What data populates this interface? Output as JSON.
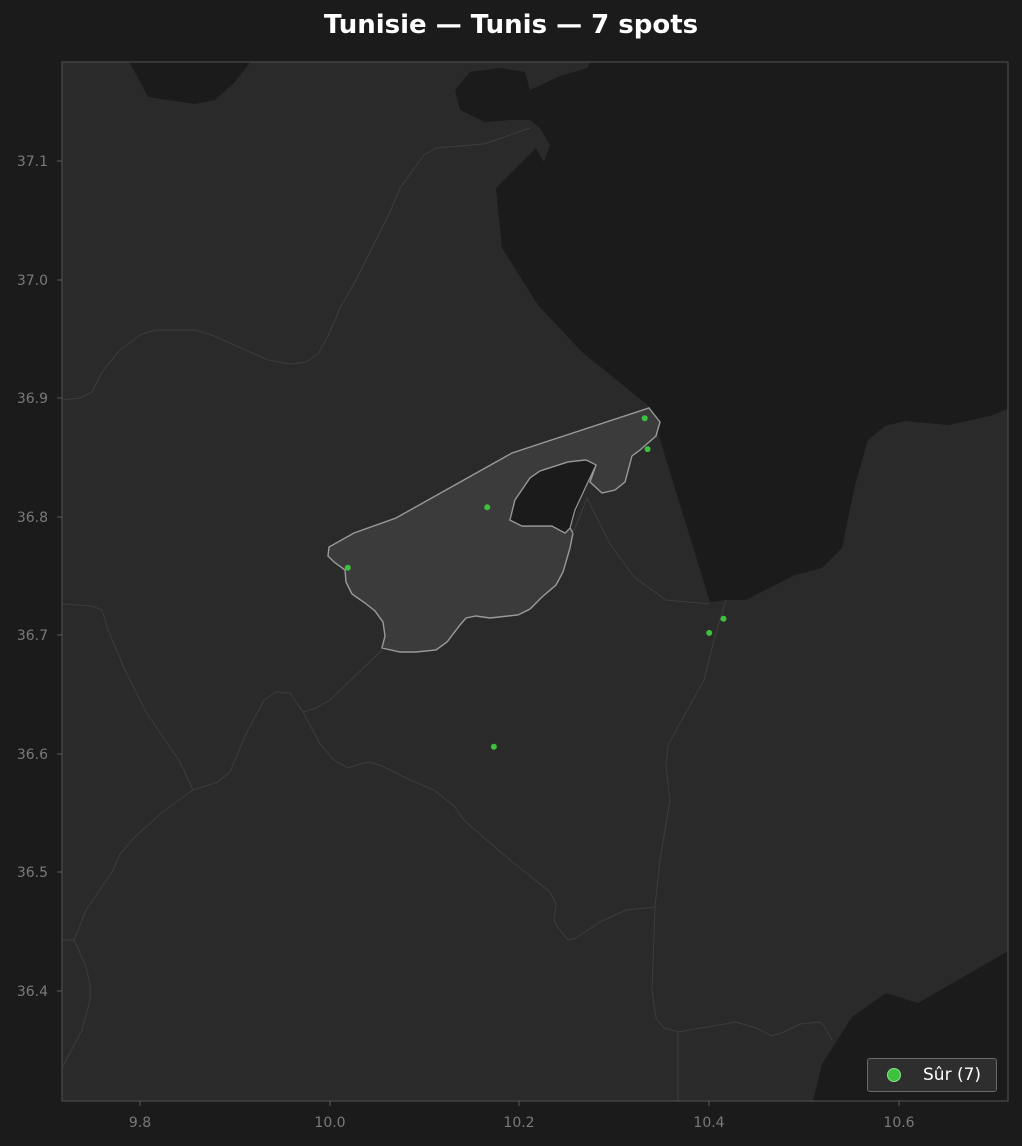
{
  "map": {
    "title": "Tunisie — Tunis — 7 spots",
    "x_ticks": [
      "9.8",
      "10.0",
      "10.2",
      "10.4",
      "10.6"
    ],
    "y_ticks": [
      "37.1",
      "37.0",
      "36.9",
      "36.8",
      "36.7",
      "36.6",
      "36.5",
      "36.4"
    ],
    "colors": {
      "background": "#1b1b1b",
      "sea": "#1b1b1b",
      "land": "#2a2a2a",
      "highlight_region": "#3b3b3b",
      "boundary": "#3a3a3a",
      "highlight_border": "#9a9a9a",
      "spot": "#3cc23c"
    },
    "legend": {
      "label": "Sûr (7)"
    },
    "spots": [
      {
        "lon": 10.332,
        "lat": 36.883
      },
      {
        "lon": 10.335,
        "lat": 36.857
      },
      {
        "lon": 10.166,
        "lat": 36.808
      },
      {
        "lon": 10.019,
        "lat": 36.757
      },
      {
        "lon": 10.415,
        "lat": 36.714
      },
      {
        "lon": 10.4,
        "lat": 36.702
      },
      {
        "lon": 10.173,
        "lat": 36.606
      }
    ]
  }
}
